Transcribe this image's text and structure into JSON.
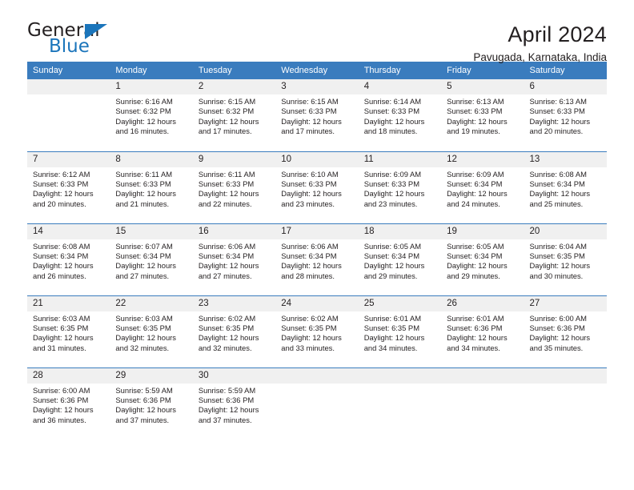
{
  "brand": {
    "name_part1": "General",
    "name_part2": "Blue",
    "triangle_color": "#1b75bb"
  },
  "header": {
    "title": "April 2024",
    "subtitle": "Pavugada, Karnataka, India"
  },
  "theme": {
    "header_bg": "#3a7cbe",
    "daynum_bg": "#f0f0f0",
    "text": "#231f20"
  },
  "weekdays": [
    "Sunday",
    "Monday",
    "Tuesday",
    "Wednesday",
    "Thursday",
    "Friday",
    "Saturday"
  ],
  "weeks": [
    [
      {
        "day": "",
        "sunrise": "",
        "sunset": "",
        "daylight1": "",
        "daylight2": ""
      },
      {
        "day": "1",
        "sunrise": "Sunrise: 6:16 AM",
        "sunset": "Sunset: 6:32 PM",
        "daylight1": "Daylight: 12 hours",
        "daylight2": "and 16 minutes."
      },
      {
        "day": "2",
        "sunrise": "Sunrise: 6:15 AM",
        "sunset": "Sunset: 6:32 PM",
        "daylight1": "Daylight: 12 hours",
        "daylight2": "and 17 minutes."
      },
      {
        "day": "3",
        "sunrise": "Sunrise: 6:15 AM",
        "sunset": "Sunset: 6:33 PM",
        "daylight1": "Daylight: 12 hours",
        "daylight2": "and 17 minutes."
      },
      {
        "day": "4",
        "sunrise": "Sunrise: 6:14 AM",
        "sunset": "Sunset: 6:33 PM",
        "daylight1": "Daylight: 12 hours",
        "daylight2": "and 18 minutes."
      },
      {
        "day": "5",
        "sunrise": "Sunrise: 6:13 AM",
        "sunset": "Sunset: 6:33 PM",
        "daylight1": "Daylight: 12 hours",
        "daylight2": "and 19 minutes."
      },
      {
        "day": "6",
        "sunrise": "Sunrise: 6:13 AM",
        "sunset": "Sunset: 6:33 PM",
        "daylight1": "Daylight: 12 hours",
        "daylight2": "and 20 minutes."
      }
    ],
    [
      {
        "day": "7",
        "sunrise": "Sunrise: 6:12 AM",
        "sunset": "Sunset: 6:33 PM",
        "daylight1": "Daylight: 12 hours",
        "daylight2": "and 20 minutes."
      },
      {
        "day": "8",
        "sunrise": "Sunrise: 6:11 AM",
        "sunset": "Sunset: 6:33 PM",
        "daylight1": "Daylight: 12 hours",
        "daylight2": "and 21 minutes."
      },
      {
        "day": "9",
        "sunrise": "Sunrise: 6:11 AM",
        "sunset": "Sunset: 6:33 PM",
        "daylight1": "Daylight: 12 hours",
        "daylight2": "and 22 minutes."
      },
      {
        "day": "10",
        "sunrise": "Sunrise: 6:10 AM",
        "sunset": "Sunset: 6:33 PM",
        "daylight1": "Daylight: 12 hours",
        "daylight2": "and 23 minutes."
      },
      {
        "day": "11",
        "sunrise": "Sunrise: 6:09 AM",
        "sunset": "Sunset: 6:33 PM",
        "daylight1": "Daylight: 12 hours",
        "daylight2": "and 23 minutes."
      },
      {
        "day": "12",
        "sunrise": "Sunrise: 6:09 AM",
        "sunset": "Sunset: 6:34 PM",
        "daylight1": "Daylight: 12 hours",
        "daylight2": "and 24 minutes."
      },
      {
        "day": "13",
        "sunrise": "Sunrise: 6:08 AM",
        "sunset": "Sunset: 6:34 PM",
        "daylight1": "Daylight: 12 hours",
        "daylight2": "and 25 minutes."
      }
    ],
    [
      {
        "day": "14",
        "sunrise": "Sunrise: 6:08 AM",
        "sunset": "Sunset: 6:34 PM",
        "daylight1": "Daylight: 12 hours",
        "daylight2": "and 26 minutes."
      },
      {
        "day": "15",
        "sunrise": "Sunrise: 6:07 AM",
        "sunset": "Sunset: 6:34 PM",
        "daylight1": "Daylight: 12 hours",
        "daylight2": "and 27 minutes."
      },
      {
        "day": "16",
        "sunrise": "Sunrise: 6:06 AM",
        "sunset": "Sunset: 6:34 PM",
        "daylight1": "Daylight: 12 hours",
        "daylight2": "and 27 minutes."
      },
      {
        "day": "17",
        "sunrise": "Sunrise: 6:06 AM",
        "sunset": "Sunset: 6:34 PM",
        "daylight1": "Daylight: 12 hours",
        "daylight2": "and 28 minutes."
      },
      {
        "day": "18",
        "sunrise": "Sunrise: 6:05 AM",
        "sunset": "Sunset: 6:34 PM",
        "daylight1": "Daylight: 12 hours",
        "daylight2": "and 29 minutes."
      },
      {
        "day": "19",
        "sunrise": "Sunrise: 6:05 AM",
        "sunset": "Sunset: 6:34 PM",
        "daylight1": "Daylight: 12 hours",
        "daylight2": "and 29 minutes."
      },
      {
        "day": "20",
        "sunrise": "Sunrise: 6:04 AM",
        "sunset": "Sunset: 6:35 PM",
        "daylight1": "Daylight: 12 hours",
        "daylight2": "and 30 minutes."
      }
    ],
    [
      {
        "day": "21",
        "sunrise": "Sunrise: 6:03 AM",
        "sunset": "Sunset: 6:35 PM",
        "daylight1": "Daylight: 12 hours",
        "daylight2": "and 31 minutes."
      },
      {
        "day": "22",
        "sunrise": "Sunrise: 6:03 AM",
        "sunset": "Sunset: 6:35 PM",
        "daylight1": "Daylight: 12 hours",
        "daylight2": "and 32 minutes."
      },
      {
        "day": "23",
        "sunrise": "Sunrise: 6:02 AM",
        "sunset": "Sunset: 6:35 PM",
        "daylight1": "Daylight: 12 hours",
        "daylight2": "and 32 minutes."
      },
      {
        "day": "24",
        "sunrise": "Sunrise: 6:02 AM",
        "sunset": "Sunset: 6:35 PM",
        "daylight1": "Daylight: 12 hours",
        "daylight2": "and 33 minutes."
      },
      {
        "day": "25",
        "sunrise": "Sunrise: 6:01 AM",
        "sunset": "Sunset: 6:35 PM",
        "daylight1": "Daylight: 12 hours",
        "daylight2": "and 34 minutes."
      },
      {
        "day": "26",
        "sunrise": "Sunrise: 6:01 AM",
        "sunset": "Sunset: 6:36 PM",
        "daylight1": "Daylight: 12 hours",
        "daylight2": "and 34 minutes."
      },
      {
        "day": "27",
        "sunrise": "Sunrise: 6:00 AM",
        "sunset": "Sunset: 6:36 PM",
        "daylight1": "Daylight: 12 hours",
        "daylight2": "and 35 minutes."
      }
    ],
    [
      {
        "day": "28",
        "sunrise": "Sunrise: 6:00 AM",
        "sunset": "Sunset: 6:36 PM",
        "daylight1": "Daylight: 12 hours",
        "daylight2": "and 36 minutes."
      },
      {
        "day": "29",
        "sunrise": "Sunrise: 5:59 AM",
        "sunset": "Sunset: 6:36 PM",
        "daylight1": "Daylight: 12 hours",
        "daylight2": "and 37 minutes."
      },
      {
        "day": "30",
        "sunrise": "Sunrise: 5:59 AM",
        "sunset": "Sunset: 6:36 PM",
        "daylight1": "Daylight: 12 hours",
        "daylight2": "and 37 minutes."
      },
      {
        "day": "",
        "sunrise": "",
        "sunset": "",
        "daylight1": "",
        "daylight2": ""
      },
      {
        "day": "",
        "sunrise": "",
        "sunset": "",
        "daylight1": "",
        "daylight2": ""
      },
      {
        "day": "",
        "sunrise": "",
        "sunset": "",
        "daylight1": "",
        "daylight2": ""
      },
      {
        "day": "",
        "sunrise": "",
        "sunset": "",
        "daylight1": "",
        "daylight2": ""
      }
    ]
  ]
}
